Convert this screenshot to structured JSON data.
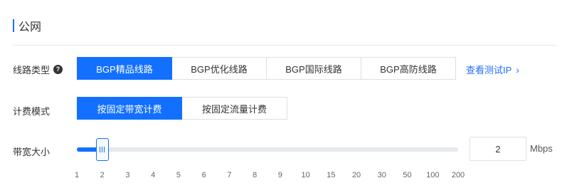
{
  "section": {
    "title": "公网"
  },
  "line_type": {
    "label": "线路类型",
    "help_icon": "question-circle-icon",
    "options": [
      "BGP精品线路",
      "BGP优化线路",
      "BGP国际线路",
      "BGP高防线路"
    ],
    "selected_index": 0,
    "test_link": "查看测试IP",
    "test_link_icon": "chevron-right-icon"
  },
  "billing_mode": {
    "label": "计费模式",
    "options": [
      "按固定带宽计费",
      "按固定流量计费"
    ],
    "selected_index": 0
  },
  "bandwidth": {
    "label": "带宽大小",
    "ticks": [
      "1",
      "2",
      "3",
      "4",
      "5",
      "6",
      "7",
      "8",
      "9",
      "10",
      "15",
      "20",
      "30",
      "50",
      "100",
      "200"
    ],
    "value": "2",
    "unit": "Mbps",
    "selected_tick_index": 1
  },
  "colors": {
    "accent": "#1370ff",
    "link": "#1f6fff",
    "track": "#e4e8ef"
  }
}
